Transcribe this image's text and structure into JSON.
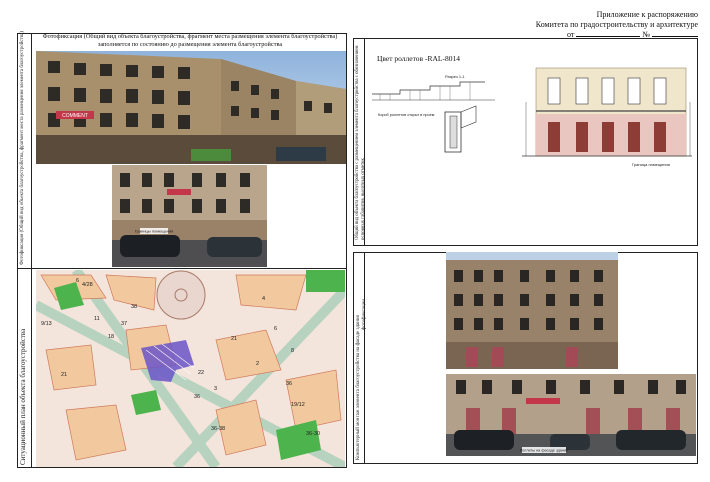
{
  "header": {
    "line1": "Приложение к распоряжению",
    "line2": "Комитета по градостроительству и архитектуре",
    "line3_prefix": "от",
    "line3_number_label": "№"
  },
  "left_top": {
    "side_label": "Фотофиксация (Общий вид объекта благоустройства, фрагмент места размещения элемента благоустройства)",
    "caption_line1": "Фотофиксация (Общий вид объекта благоустройства, фрагмент места размещения элемента благоустройства)",
    "caption_line2": "заполняется по состоянию до размещения элемента благоустройства",
    "sign_text": "COMMENT",
    "boundary_label": "Границы помещения"
  },
  "left_bottom": {
    "side_label": "Ситуационный план объекта благоустройства",
    "map_labels": [
      "6",
      "11",
      "38",
      "4/28",
      "9/13",
      "37",
      "18",
      "22",
      "3",
      "36",
      "36-38",
      "4",
      "21",
      "6",
      "2",
      "8",
      "19/12",
      "36-30",
      "21",
      "36"
    ]
  },
  "right_top": {
    "side_label": "Общий вид объекта благоустройства с размещением элемента благоустройства с обозначением основных габаритов, высотных отметок",
    "color_title": "Цвет роллетов -RAL-8014",
    "section_label": "Разрез 1-1",
    "plan_label": "Короб роллетов открыт в проем",
    "elevation_note": "Граница помещения"
  },
  "right_bottom": {
    "side_label": "Компьютерный монтаж элемента благоустройства на фасаде здания",
    "side_label2": "фотофиксации",
    "bottom_caption": "Роллеты на фасаде здания"
  }
}
